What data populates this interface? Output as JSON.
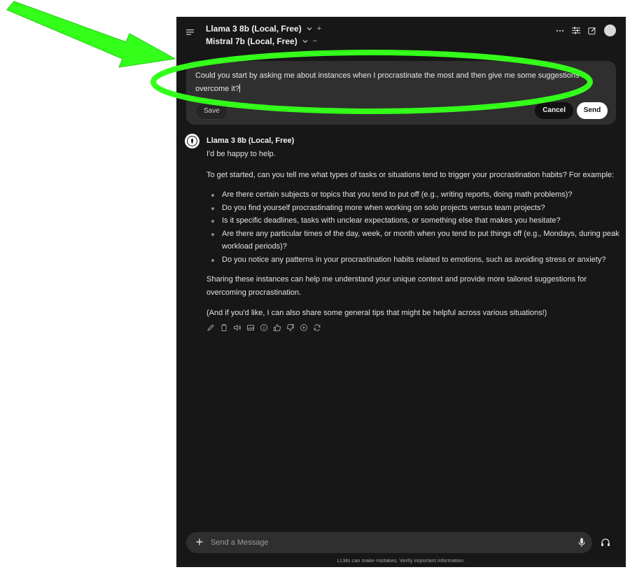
{
  "header": {
    "models": [
      {
        "name": "Llama 3 8b (Local, Free)",
        "action": "+"
      },
      {
        "name": "Mistral 7b (Local, Free)",
        "action": "−"
      }
    ],
    "icons": [
      "menu-icon",
      "more-icon",
      "controls-icon",
      "new-chat-icon",
      "avatar"
    ]
  },
  "edit": {
    "text": "Could you start by asking me about instances when I procrastinate the most and then give me some suggestions to overcome it?",
    "save_label": "Save",
    "cancel_label": "Cancel",
    "send_label": "Send"
  },
  "response": {
    "author": "Llama 3 8b (Local, Free)",
    "intro": "I'd be happy to help.",
    "lead": "To get started, can you tell me what types of tasks or situations tend to trigger your procrastination habits? For example:",
    "bullets": [
      "Are there certain subjects or topics that you tend to put off (e.g., writing reports, doing math problems)?",
      "Do you find yourself procrastinating more when working on solo projects versus team projects?",
      "Is it specific deadlines, tasks with unclear expectations, or something else that makes you hesitate?",
      "Are there any particular times of the day, week, or month when you tend to put things off (e.g., Mondays, during peak workload periods)?",
      "Do you notice any patterns in your procrastination habits related to emotions, such as avoiding stress or anxiety?"
    ],
    "share": "Sharing these instances can help me understand your unique context and provide more tailored suggestions for overcoming procrastination.",
    "final": "(And if you'd like, I can also share some general tips that might be helpful across various situations!)",
    "action_icons": [
      "edit-icon",
      "copy-icon",
      "read-aloud-icon",
      "image-icon",
      "info-icon",
      "thumbs-up-icon",
      "thumbs-down-icon",
      "continue-icon",
      "regenerate-icon"
    ]
  },
  "composer": {
    "placeholder": "Send a Message",
    "disclaimer": "LLMs can make mistakes. Verify important information."
  },
  "annotation": {
    "arrow_color": "#33ff1a",
    "ellipse_color": "#33ff1a"
  }
}
